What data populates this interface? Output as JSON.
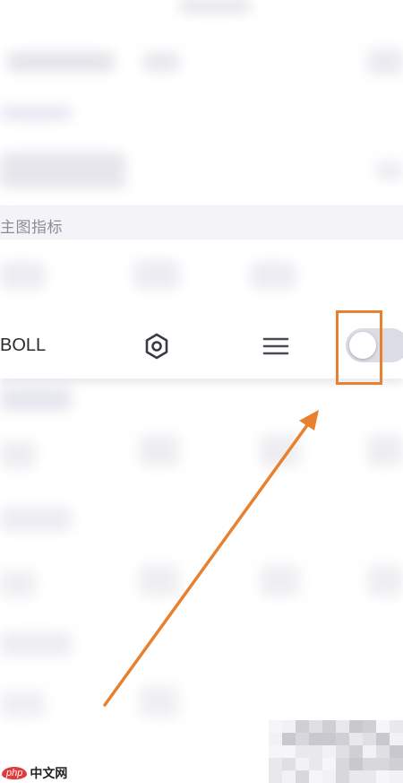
{
  "section": {
    "title": "主图指标"
  },
  "indicator": {
    "name": "BOLL",
    "settings_icon": "settings-hexagon-icon",
    "drag_icon": "drag-handle-icon",
    "toggle_state": "off"
  },
  "annotation": {
    "highlight_color": "#e8812f",
    "arrow_color": "#e8812f"
  },
  "watermark": {
    "logo_mark": "php",
    "logo_text": "中文网"
  }
}
